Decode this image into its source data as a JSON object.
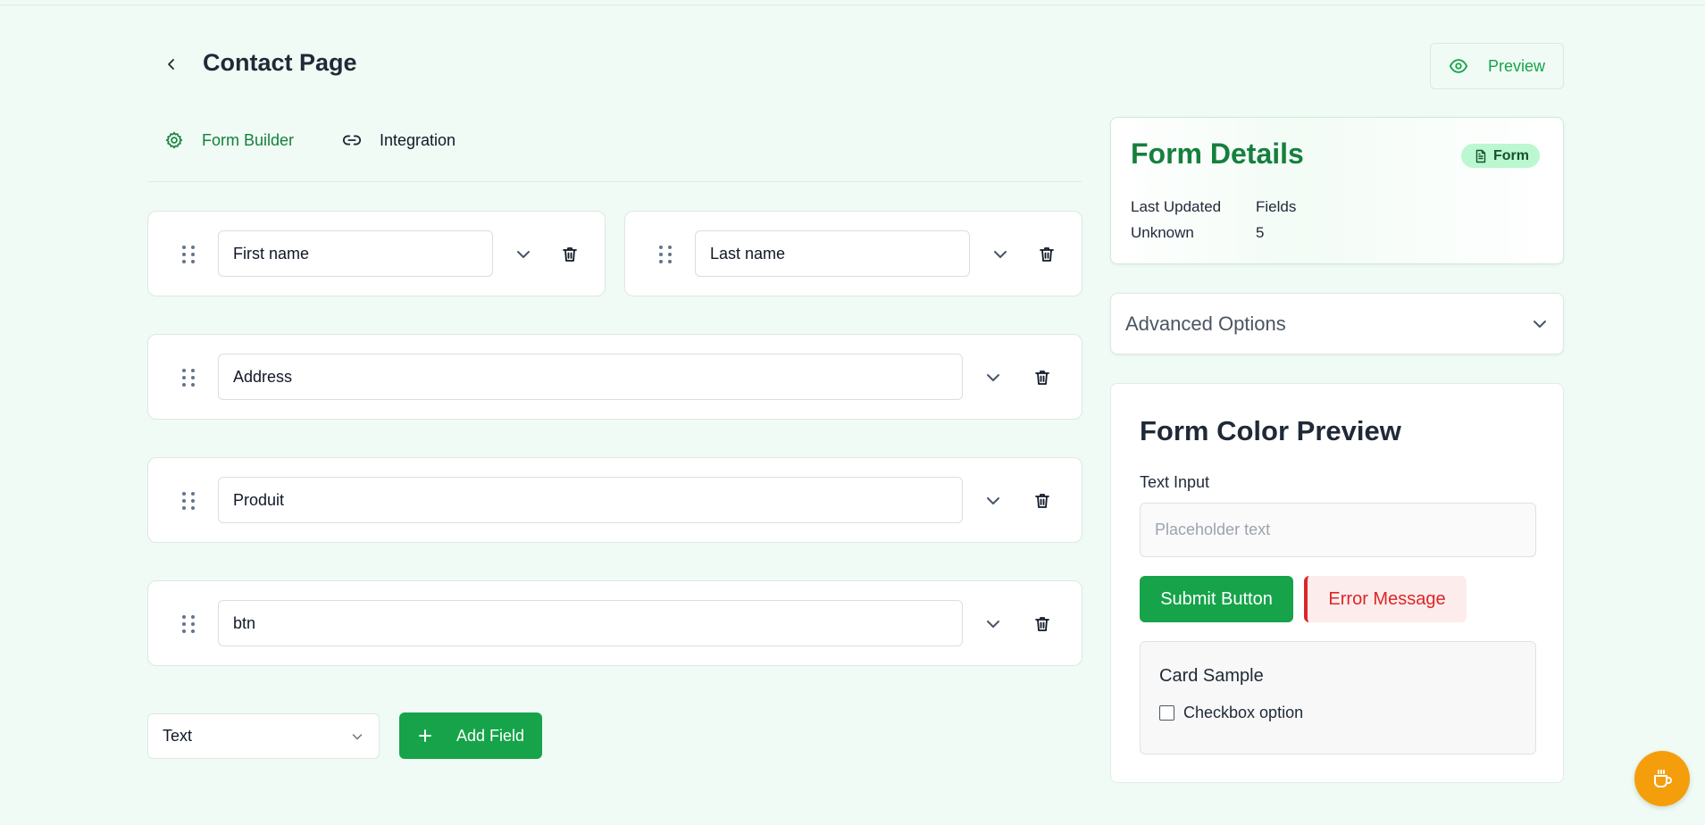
{
  "header": {
    "title": "Contact Page",
    "preview_label": "Preview"
  },
  "tabs": [
    {
      "label": "Form Builder",
      "icon": "gear-icon",
      "active": true
    },
    {
      "label": "Integration",
      "icon": "link-icon",
      "active": false
    }
  ],
  "fields": [
    {
      "value": "First name"
    },
    {
      "value": "Last name"
    },
    {
      "value": "Address"
    },
    {
      "value": "Produit"
    },
    {
      "value": "btn"
    }
  ],
  "add_controls": {
    "type_selected": "Text",
    "add_label": "Add Field"
  },
  "details": {
    "title": "Form Details",
    "badge": "Form",
    "last_updated_label": "Last Updated",
    "last_updated_value": "Unknown",
    "fields_label": "Fields",
    "fields_value": "5"
  },
  "advanced": {
    "label": "Advanced Options"
  },
  "color_preview": {
    "title": "Form Color Preview",
    "input_label": "Text Input",
    "input_placeholder": "Placeholder text",
    "submit_label": "Submit Button",
    "error_label": "Error Message",
    "card_title": "Card Sample",
    "checkbox_label": "Checkbox option"
  },
  "colors": {
    "background": "#effbf4",
    "accent": "#16a34a",
    "accent_dark": "#15803d",
    "error": "#dc2626",
    "fab": "#f59e0b"
  }
}
